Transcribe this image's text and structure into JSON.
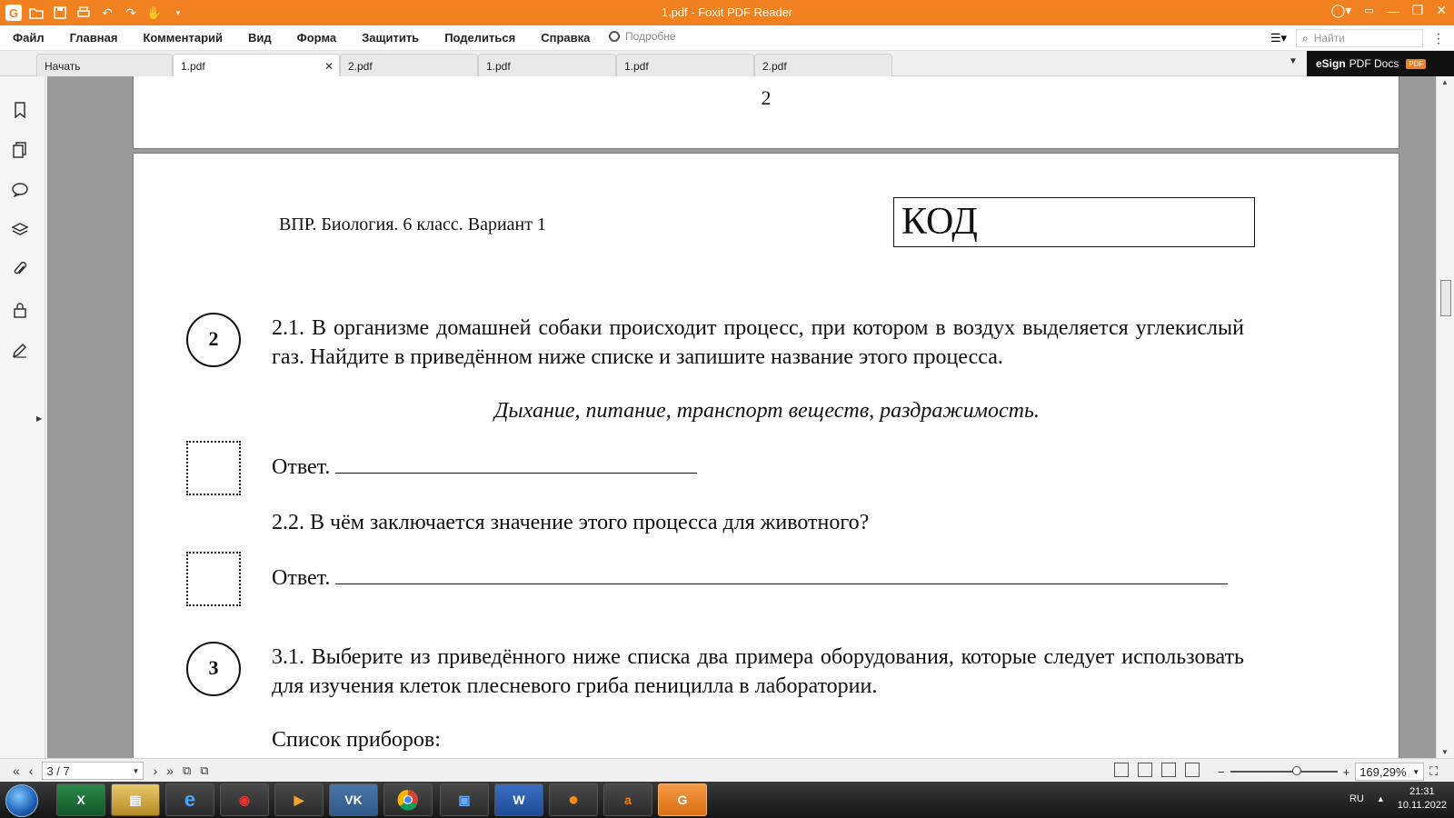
{
  "window": {
    "title": "1.pdf - Foxit PDF Reader"
  },
  "menu": [
    "Файл",
    "Главная",
    "Комментарий",
    "Вид",
    "Форма",
    "Защитить",
    "Поделиться",
    "Справка"
  ],
  "tell_me": "Подробне",
  "search": {
    "placeholder": "Найти"
  },
  "tabs": [
    {
      "label": "Начать"
    },
    {
      "label": "1.pdf",
      "active": true
    },
    {
      "label": "2.pdf"
    },
    {
      "label": "1.pdf"
    },
    {
      "label": "1.pdf"
    },
    {
      "label": "2.pdf"
    }
  ],
  "esign": {
    "bold": "eSign",
    "rest": "PDF Docs",
    "badge": "PDF"
  },
  "document": {
    "prev_page_number": "2",
    "header": "ВПР. Биология. 6 класс. Вариант 1",
    "code_label": "КОД",
    "q2": {
      "number": "2",
      "text_2_1": "2.1. В организме домашней собаки происходит процесс, при котором в воздух выделяется углекислый газ. Найдите в приведённом ниже списке и запишите название этого процесса.",
      "options": "Дыхание, питание, транспорт веществ, раздражимость.",
      "answer_label_1": "Ответ.",
      "text_2_2": "2.2. В чём заключается значение этого процесса для животного?",
      "answer_label_2": "Ответ."
    },
    "q3": {
      "number": "3",
      "text_3_1": "3.1. Выберите из приведённого ниже списка два примера оборудования, которые следует использовать для изучения клеток плесневого гриба пеницилла в лаборатории.",
      "list_heading": "Список приборов:"
    }
  },
  "statusbar": {
    "page_indicator": "3 / 7",
    "zoom": "169,29%",
    "zoom_slider_fraction": 0.62
  },
  "taskbar": {
    "apps": [
      "Excel",
      "Explorer",
      "Internet Explorer",
      "Antivirus",
      "Media Player",
      "VK",
      "Chrome",
      "Storage",
      "Word",
      "Firefox",
      "Avast",
      "Foxit PDF"
    ],
    "lang": "RU",
    "time": "21:31",
    "date": "10.11.2022"
  }
}
